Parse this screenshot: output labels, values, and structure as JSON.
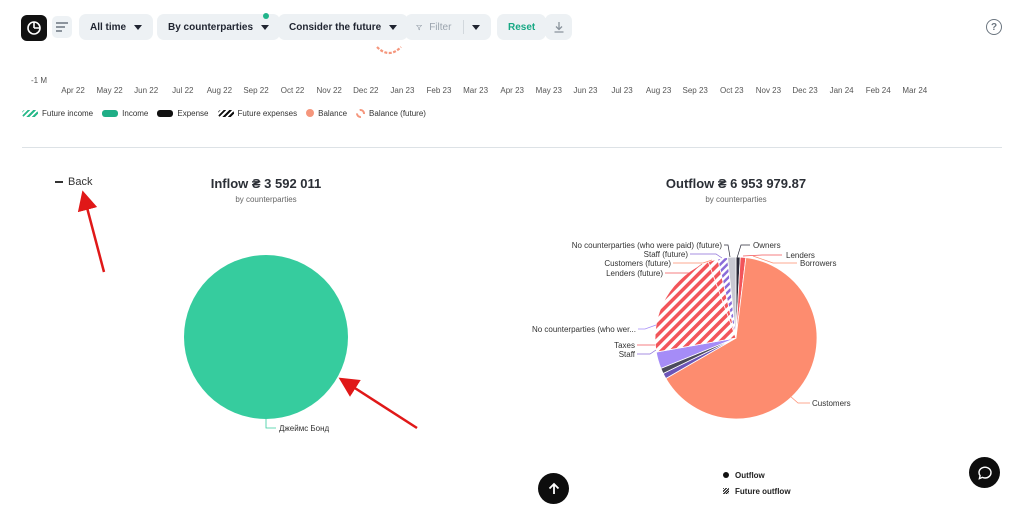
{
  "toolbar": {
    "period": "All time",
    "grouping": "By counterparties",
    "future": "Consider the future",
    "filter": "Filter",
    "reset": "Reset",
    "help": "?"
  },
  "timeline": {
    "y_label": "-1 M",
    "months": [
      "Apr 22",
      "May 22",
      "Jun 22",
      "Jul 22",
      "Aug 22",
      "Sep 22",
      "Oct 22",
      "Nov 22",
      "Dec 22",
      "Jan 23",
      "Feb 23",
      "Mar 23",
      "Apr 23",
      "May 23",
      "Jun 23",
      "Jul 23",
      "Aug 23",
      "Sep 23",
      "Oct 23",
      "Nov 23",
      "Dec 23",
      "Jan 24",
      "Feb 24",
      "Mar 24"
    ],
    "legend": [
      "Future income",
      "Income",
      "Expense",
      "Future expenses",
      "Balance",
      "Balance (future)"
    ]
  },
  "back_label": "Back",
  "inflow": {
    "title": "Inflow ₴ 3 592 011",
    "subtitle": "by counterparties",
    "slice_label": "Джеймс Бонд",
    "color": "#36cc9e"
  },
  "outflow": {
    "title": "Outflow ₴ 6 953 979.87",
    "subtitle": "by counterparties",
    "labels": {
      "owners": "Owners",
      "lenders": "Lenders",
      "borrowers": "Borrowers",
      "no_cp_paid_future": "No counterparties (who were paid) (future)",
      "staff_future": "Staff (future)",
      "customers_future": "Customers (future)",
      "lenders_future": "Lenders (future)",
      "no_cp_were": "No counterparties (who wer...",
      "taxes": "Taxes",
      "staff": "Staff",
      "customers": "Customers"
    },
    "legend": [
      "Outflow",
      "Future outflow"
    ],
    "colors": {
      "customers": "#fd8c6f",
      "future": "#f2555a",
      "purple": "#a58cf7",
      "dark": "#2b2b3a"
    }
  }
}
